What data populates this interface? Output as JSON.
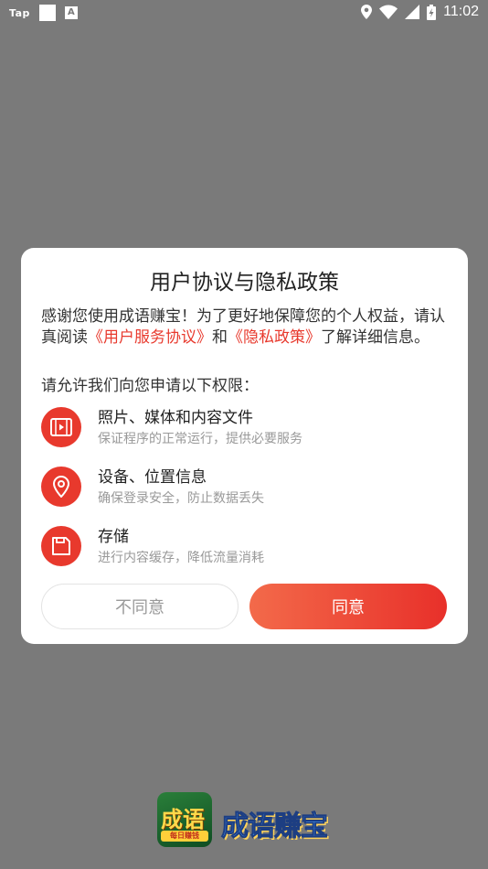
{
  "status_bar": {
    "left_label": "Tap",
    "notif_letter": "A",
    "time": "11:02"
  },
  "dialog": {
    "title": "用户协议与隐私政策",
    "intro": {
      "part1": "感谢您使用成语赚宝！为了更好地保障您的个人权益，请认真阅读",
      "link1": "《用户服务协议》",
      "part2": "和",
      "link2": "《隐私政策》",
      "part3": "了解详细信息。"
    },
    "permissions_heading": "请允许我们向您申请以下权限：",
    "permissions": [
      {
        "title": "照片、媒体和内容文件",
        "desc": "保证程序的正常运行，提供必要服务",
        "icon": "media-file-icon"
      },
      {
        "title": "设备、位置信息",
        "desc": "确保登录安全，防止数据丢失",
        "icon": "location-pin-icon"
      },
      {
        "title": "存储",
        "desc": "进行内容缓存，降低流量消耗",
        "icon": "storage-icon"
      }
    ],
    "disagree_label": "不同意",
    "agree_label": "同意"
  },
  "branding": {
    "icon_text": "成语",
    "icon_band": "每日赚钱",
    "app_name": "成语赚宝"
  },
  "colors": {
    "accent": "#e8392d",
    "overlay": "#7a7a7a"
  }
}
